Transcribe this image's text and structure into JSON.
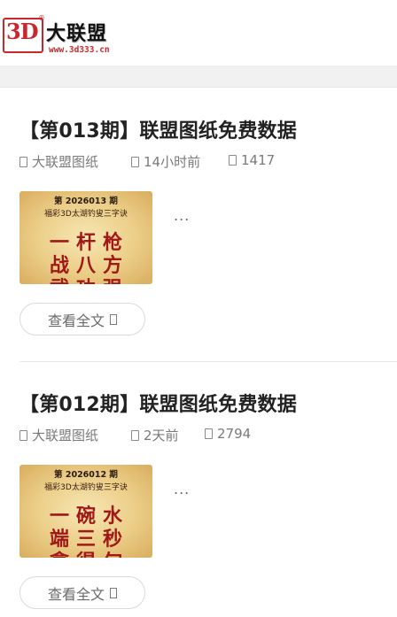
{
  "logo": {
    "mark": "3D",
    "registered": "®",
    "name": "大联盟",
    "url": "www.3d333.cn"
  },
  "posts": [
    {
      "title": "【第013期】联盟图纸免费数据",
      "author": "大联盟图纸",
      "time": "14小时前",
      "views": "1417",
      "thumb": {
        "issue": "第 2026013 期",
        "subtitle": "福彩3D太湖钓叟三字诀",
        "row1": "一杆枪",
        "row2": "战八方",
        "row3": "武功强"
      },
      "ellipsis": "...",
      "read_more": "查看全文"
    },
    {
      "title": "【第012期】联盟图纸免费数据",
      "author": "大联盟图纸",
      "time": "2天前",
      "views": "2794",
      "thumb": {
        "issue": "第 2026012 期",
        "subtitle": "福彩3D太湖钓叟三字诀",
        "row1": "一碗水",
        "row2": "端三秒",
        "row3": "拿得旬"
      },
      "ellipsis": "...",
      "read_more": "查看全文"
    }
  ]
}
